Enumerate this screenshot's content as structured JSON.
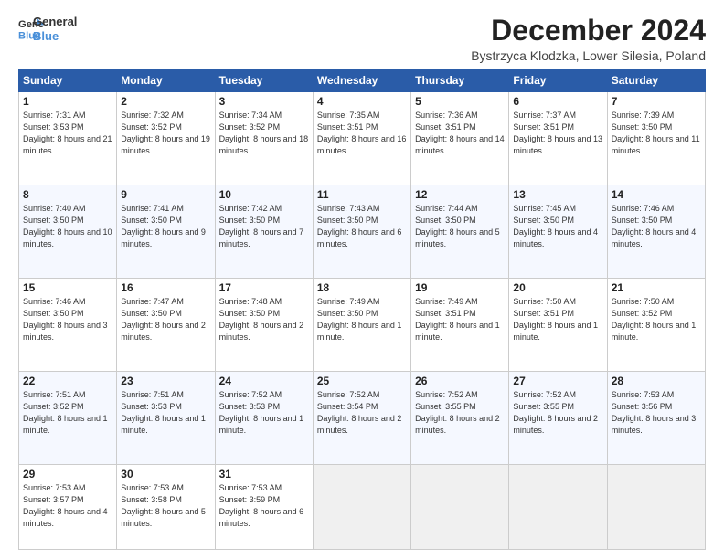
{
  "logo": {
    "line1": "General",
    "line2": "Blue"
  },
  "title": "December 2024",
  "location": "Bystrzyca Klodzka, Lower Silesia, Poland",
  "weekdays": [
    "Sunday",
    "Monday",
    "Tuesday",
    "Wednesday",
    "Thursday",
    "Friday",
    "Saturday"
  ],
  "weeks": [
    [
      {
        "day": "1",
        "sunrise": "7:31 AM",
        "sunset": "3:53 PM",
        "daylight": "8 hours and 21 minutes."
      },
      {
        "day": "2",
        "sunrise": "7:32 AM",
        "sunset": "3:52 PM",
        "daylight": "8 hours and 19 minutes."
      },
      {
        "day": "3",
        "sunrise": "7:34 AM",
        "sunset": "3:52 PM",
        "daylight": "8 hours and 18 minutes."
      },
      {
        "day": "4",
        "sunrise": "7:35 AM",
        "sunset": "3:51 PM",
        "daylight": "8 hours and 16 minutes."
      },
      {
        "day": "5",
        "sunrise": "7:36 AM",
        "sunset": "3:51 PM",
        "daylight": "8 hours and 14 minutes."
      },
      {
        "day": "6",
        "sunrise": "7:37 AM",
        "sunset": "3:51 PM",
        "daylight": "8 hours and 13 minutes."
      },
      {
        "day": "7",
        "sunrise": "7:39 AM",
        "sunset": "3:50 PM",
        "daylight": "8 hours and 11 minutes."
      }
    ],
    [
      {
        "day": "8",
        "sunrise": "7:40 AM",
        "sunset": "3:50 PM",
        "daylight": "8 hours and 10 minutes."
      },
      {
        "day": "9",
        "sunrise": "7:41 AM",
        "sunset": "3:50 PM",
        "daylight": "8 hours and 9 minutes."
      },
      {
        "day": "10",
        "sunrise": "7:42 AM",
        "sunset": "3:50 PM",
        "daylight": "8 hours and 7 minutes."
      },
      {
        "day": "11",
        "sunrise": "7:43 AM",
        "sunset": "3:50 PM",
        "daylight": "8 hours and 6 minutes."
      },
      {
        "day": "12",
        "sunrise": "7:44 AM",
        "sunset": "3:50 PM",
        "daylight": "8 hours and 5 minutes."
      },
      {
        "day": "13",
        "sunrise": "7:45 AM",
        "sunset": "3:50 PM",
        "daylight": "8 hours and 4 minutes."
      },
      {
        "day": "14",
        "sunrise": "7:46 AM",
        "sunset": "3:50 PM",
        "daylight": "8 hours and 4 minutes."
      }
    ],
    [
      {
        "day": "15",
        "sunrise": "7:46 AM",
        "sunset": "3:50 PM",
        "daylight": "8 hours and 3 minutes."
      },
      {
        "day": "16",
        "sunrise": "7:47 AM",
        "sunset": "3:50 PM",
        "daylight": "8 hours and 2 minutes."
      },
      {
        "day": "17",
        "sunrise": "7:48 AM",
        "sunset": "3:50 PM",
        "daylight": "8 hours and 2 minutes."
      },
      {
        "day": "18",
        "sunrise": "7:49 AM",
        "sunset": "3:50 PM",
        "daylight": "8 hours and 1 minute."
      },
      {
        "day": "19",
        "sunrise": "7:49 AM",
        "sunset": "3:51 PM",
        "daylight": "8 hours and 1 minute."
      },
      {
        "day": "20",
        "sunrise": "7:50 AM",
        "sunset": "3:51 PM",
        "daylight": "8 hours and 1 minute."
      },
      {
        "day": "21",
        "sunrise": "7:50 AM",
        "sunset": "3:52 PM",
        "daylight": "8 hours and 1 minute."
      }
    ],
    [
      {
        "day": "22",
        "sunrise": "7:51 AM",
        "sunset": "3:52 PM",
        "daylight": "8 hours and 1 minute."
      },
      {
        "day": "23",
        "sunrise": "7:51 AM",
        "sunset": "3:53 PM",
        "daylight": "8 hours and 1 minute."
      },
      {
        "day": "24",
        "sunrise": "7:52 AM",
        "sunset": "3:53 PM",
        "daylight": "8 hours and 1 minute."
      },
      {
        "day": "25",
        "sunrise": "7:52 AM",
        "sunset": "3:54 PM",
        "daylight": "8 hours and 2 minutes."
      },
      {
        "day": "26",
        "sunrise": "7:52 AM",
        "sunset": "3:55 PM",
        "daylight": "8 hours and 2 minutes."
      },
      {
        "day": "27",
        "sunrise": "7:52 AM",
        "sunset": "3:55 PM",
        "daylight": "8 hours and 2 minutes."
      },
      {
        "day": "28",
        "sunrise": "7:53 AM",
        "sunset": "3:56 PM",
        "daylight": "8 hours and 3 minutes."
      }
    ],
    [
      {
        "day": "29",
        "sunrise": "7:53 AM",
        "sunset": "3:57 PM",
        "daylight": "8 hours and 4 minutes."
      },
      {
        "day": "30",
        "sunrise": "7:53 AM",
        "sunset": "3:58 PM",
        "daylight": "8 hours and 5 minutes."
      },
      {
        "day": "31",
        "sunrise": "7:53 AM",
        "sunset": "3:59 PM",
        "daylight": "8 hours and 6 minutes."
      },
      null,
      null,
      null,
      null
    ]
  ]
}
